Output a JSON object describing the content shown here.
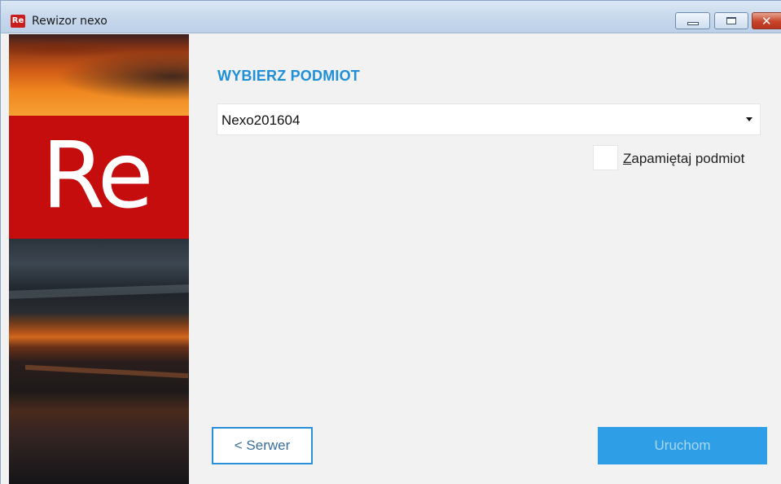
{
  "window": {
    "title": "Rewizor nexo",
    "app_icon_text": "Re"
  },
  "sidebar": {
    "logo_text": "Re"
  },
  "main": {
    "heading": "WYBIERZ PODMIOT",
    "entity_select": {
      "selected_value": "Nexo201604"
    },
    "remember_checkbox": {
      "checked": false,
      "label_mnemonic": "Z",
      "label_rest": "apamiętaj podmiot"
    },
    "buttons": {
      "back_label": "< Serwer",
      "run_label": "Uruchom"
    }
  },
  "colors": {
    "accent": "#1f8fd8",
    "primary_button": "#2e9ee6",
    "logo_red": "#c50d0d"
  }
}
